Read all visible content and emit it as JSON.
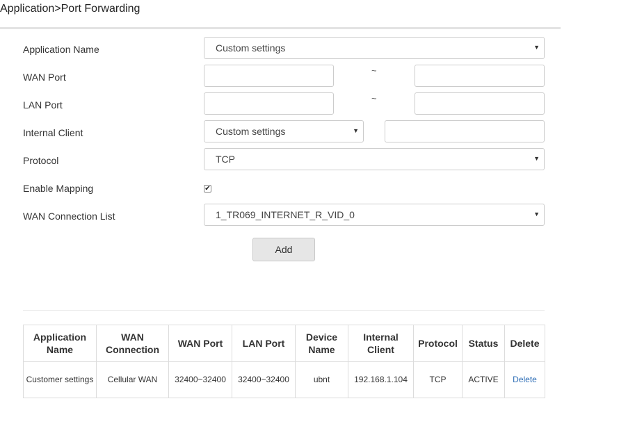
{
  "breadcrumb": "Application>Port Forwarding",
  "form": {
    "application_name": {
      "label": "Application Name",
      "value": "Custom settings"
    },
    "wan_port": {
      "label": "WAN Port",
      "start": "",
      "end": "",
      "separator": "~"
    },
    "lan_port": {
      "label": "LAN Port",
      "start": "",
      "end": "",
      "separator": "~"
    },
    "internal_client": {
      "label": "Internal Client",
      "value": "Custom settings",
      "ip": ""
    },
    "protocol": {
      "label": "Protocol",
      "value": "TCP"
    },
    "enable_mapping": {
      "label": "Enable Mapping",
      "checked": true
    },
    "wan_connection_list": {
      "label": "WAN Connection List",
      "value": "1_TR069_INTERNET_R_VID_0"
    },
    "add_label": "Add"
  },
  "table": {
    "headers": [
      "Application Name",
      "WAN Connection",
      "WAN Port",
      "LAN Port",
      "Device Name",
      "Internal Client",
      "Protocol",
      "Status",
      "Delete"
    ],
    "rows": [
      {
        "app_name": "Customer settings",
        "wan_connection": "Cellular WAN",
        "wan_port": "32400~32400",
        "lan_port": "32400~32400",
        "device_name": "ubnt",
        "internal_client": "192.168.1.104",
        "protocol": "TCP",
        "status": "ACTIVE",
        "delete_label": "Delete"
      }
    ]
  },
  "colors": {
    "link": "#2a6bb5",
    "button_bg": "#e6e6e6",
    "border": "#cccccc"
  }
}
